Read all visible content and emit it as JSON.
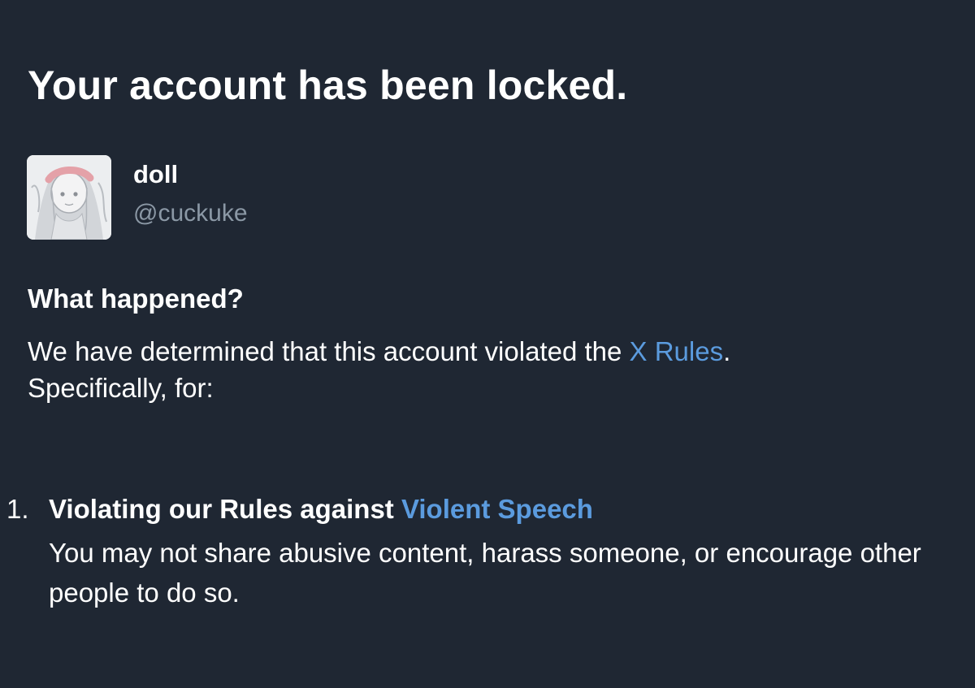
{
  "title": "Your account has been locked.",
  "account": {
    "display_name": "doll",
    "handle": "@cuckuke"
  },
  "what_happened": {
    "heading": "What happened?",
    "text_before_link": "We have determined that this account violated the ",
    "rules_link": "X Rules",
    "text_after_link": ".",
    "specifically": "Specifically, for:"
  },
  "violations": [
    {
      "number": "1.",
      "title_prefix": "Violating our Rules against ",
      "title_link": "Violent Speech",
      "description": "You may not share abusive content, harass someone, or encourage other people to do so."
    }
  ],
  "colors": {
    "background": "#1f2733",
    "text": "#ffffff",
    "muted": "#8b98a5",
    "link": "#5b9bde"
  }
}
